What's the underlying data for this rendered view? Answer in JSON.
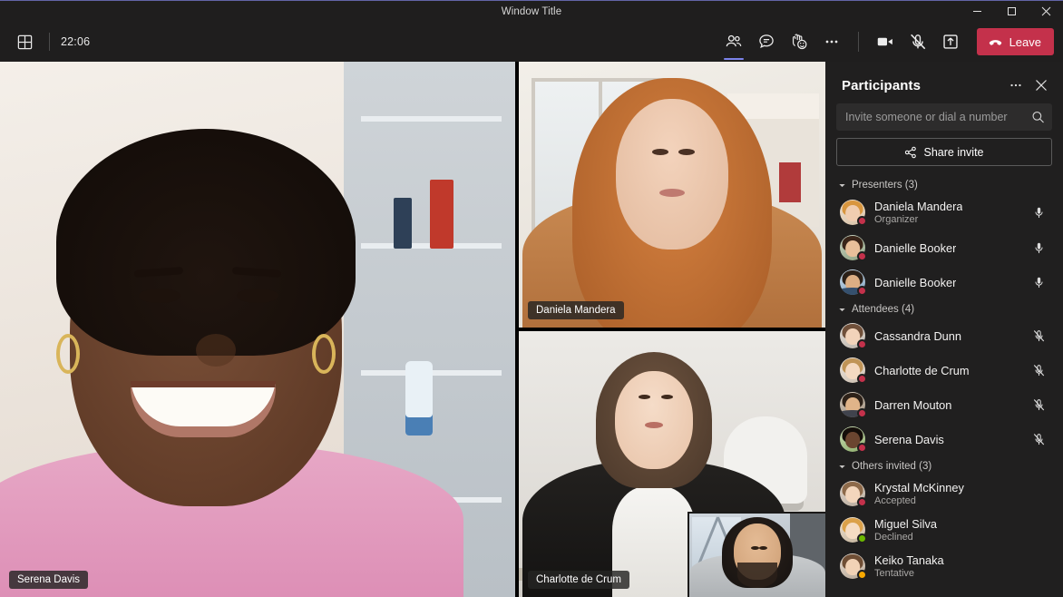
{
  "window": {
    "title": "Window Title",
    "controls": {
      "minimize": "–",
      "maximize": "□",
      "close": "✕"
    }
  },
  "toolbar": {
    "layout_icon": "grid-layout-icon",
    "timer": "22:06",
    "people_label": "People",
    "chat_label": "Chat",
    "reactions_label": "Reactions",
    "more_label": "More actions",
    "camera_label": "Camera",
    "mic_label": "Mic muted",
    "share_label": "Share content",
    "leave_label": "Leave"
  },
  "stage": {
    "tiles": [
      {
        "name": "Serena Davis",
        "scene": "sceneA"
      },
      {
        "name": "Daniela Mandera",
        "scene": "sceneB"
      },
      {
        "name": "Charlotte de Crum",
        "scene": "sceneC"
      }
    ],
    "pip": {
      "name": "pip-video"
    }
  },
  "panel": {
    "title": "Participants",
    "more_label": "More options",
    "close_label": "Close",
    "search": {
      "placeholder": "Invite someone or dial a number",
      "value": ""
    },
    "share_invite_label": "Share invite",
    "groups": [
      {
        "heading": "Presenters (3)",
        "people": [
          {
            "name": "Daniela Mandera",
            "sub": "Organizer",
            "presence": "busy",
            "mic": "unmuted"
          },
          {
            "name": "Danielle Booker",
            "sub": "",
            "presence": "busy",
            "mic": "unmuted"
          },
          {
            "name": "Danielle Booker",
            "sub": "",
            "presence": "busy",
            "mic": "unmuted"
          }
        ]
      },
      {
        "heading": "Attendees (4)",
        "people": [
          {
            "name": "Cassandra Dunn",
            "sub": "",
            "presence": "busy",
            "mic": "muted"
          },
          {
            "name": "Charlotte de Crum",
            "sub": "",
            "presence": "busy",
            "mic": "muted"
          },
          {
            "name": "Darren Mouton",
            "sub": "",
            "presence": "busy",
            "mic": "muted"
          },
          {
            "name": "Serena Davis",
            "sub": "",
            "presence": "busy",
            "mic": "muted"
          }
        ]
      },
      {
        "heading": "Others invited (3)",
        "people": [
          {
            "name": "Krystal McKinney",
            "sub": "Accepted",
            "presence": "busy",
            "mic": "none"
          },
          {
            "name": "Miguel Silva",
            "sub": "Declined",
            "presence": "available",
            "mic": "none"
          },
          {
            "name": "Keiko Tanaka",
            "sub": "Tentative",
            "presence": "away",
            "mic": "none"
          }
        ]
      }
    ]
  },
  "colors": {
    "accent": "#6264a7",
    "accent_underline": "#7b83eb",
    "leave_red": "#c4314b",
    "panel_bg": "#201f1f",
    "chrome_bg": "#1f1e1e",
    "presence_busy": "#c4314b",
    "presence_available": "#6bb700",
    "presence_away": "#f8a800"
  }
}
